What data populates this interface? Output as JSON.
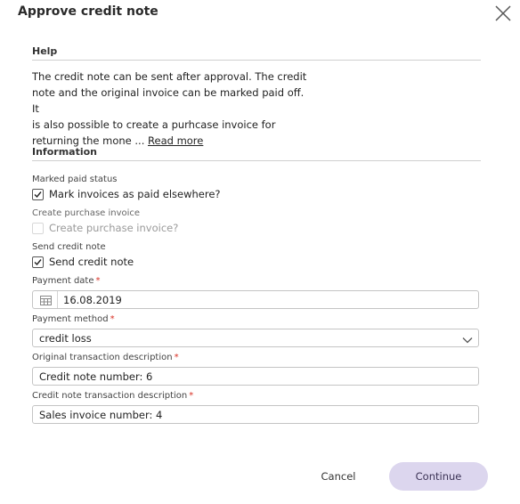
{
  "dialog": {
    "title": "Approve credit note",
    "close_icon": "close-icon"
  },
  "help": {
    "heading": "Help",
    "line1": "The credit note can be sent after approval. The credit",
    "line2": "note and the original invoice can be marked paid off. It",
    "line3": "is also possible to create a purhcase invoice for",
    "line4": "returning the mone ...",
    "read_more": "Read more"
  },
  "information": {
    "heading": "Information",
    "marked_paid": {
      "label": "Marked paid status",
      "checkbox_label": "Mark invoices as paid elsewhere?",
      "checked": true
    },
    "create_purchase": {
      "label": "Create purchase invoice",
      "checkbox_label": "Create purchase invoice?",
      "checked": false,
      "disabled": true
    },
    "send_credit": {
      "label": "Send credit note",
      "checkbox_label": "Send credit note",
      "checked": true
    },
    "payment_date": {
      "label": "Payment date",
      "required_mark": "*",
      "value": "16.08.2019",
      "icon": "calendar-icon"
    },
    "payment_method": {
      "label": "Payment method",
      "required_mark": "*",
      "value": "credit loss",
      "icon": "chevron-down-icon"
    },
    "original_desc": {
      "label": "Original transaction description",
      "required_mark": "*",
      "value": "Credit note number: 6"
    },
    "credit_desc": {
      "label": "Credit note transaction description",
      "required_mark": "*",
      "value": "Sales invoice number: 4"
    }
  },
  "buttons": {
    "cancel": "Cancel",
    "continue": "Continue"
  },
  "colors": {
    "continue_bg": "#dcd6ee",
    "required": "#d93025",
    "divider": "#cfcfcf"
  }
}
